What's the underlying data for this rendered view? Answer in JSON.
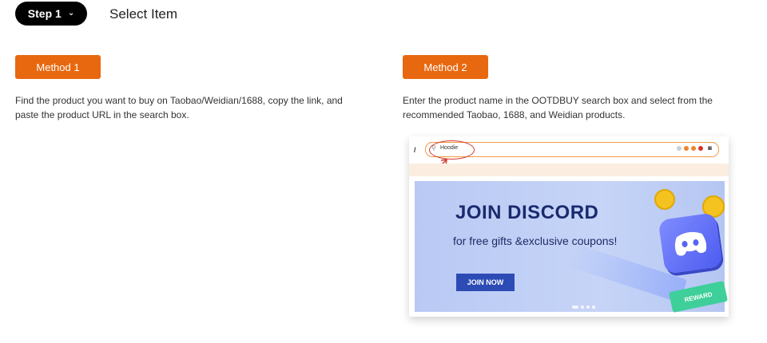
{
  "header": {
    "step_label": "Step 1",
    "step_icon": "chevron-down-icon",
    "title": "Select Item"
  },
  "method1": {
    "label": "Method 1",
    "description": "Find the product you want to buy on Taobao/Weidian/1688, copy the link, and paste the product URL in the search box."
  },
  "method2": {
    "label": "Method 2",
    "description": "Enter the product name in the OOTDBUY search box and select from the recommended Taobao, 1688, and Weidian products.",
    "illustration": {
      "search_query": "Hoodie",
      "banner_title": "JOIN DISCORD",
      "banner_subtitle": "for free gifts &exclusive coupons!",
      "banner_button": "JOIN NOW",
      "ticket_text": "REWARD",
      "search_icon": "search-icon",
      "camera_icon": "camera-icon"
    }
  },
  "colors": {
    "accent": "#e8680f",
    "pill": "#000000",
    "banner_bg": "#c2d1f6",
    "banner_button": "#2d4bb5"
  }
}
